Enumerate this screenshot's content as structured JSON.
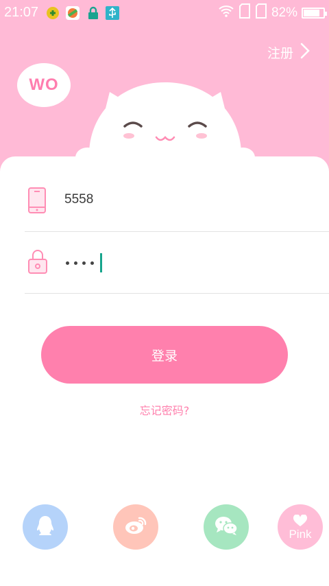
{
  "status_bar": {
    "time": "21:07",
    "battery": "82%",
    "battery_level": 0.82,
    "icons": [
      "game-app-icon",
      "color-app-icon",
      "lock-icon",
      "usb-icon",
      "wifi-icon",
      "sim-card-icon",
      "sim-card-icon",
      "battery-icon"
    ]
  },
  "header": {
    "register_label": "注册",
    "bubble_text": "WO",
    "background_color": "#ffbad6"
  },
  "login_form": {
    "phone_value": "5558",
    "password_dot_count": 4,
    "login_label": "登录",
    "forgot_label": "忘记密码?"
  },
  "social": {
    "pink_label": "Pink",
    "items": [
      "qq-icon",
      "weibo-icon",
      "wechat-icon",
      "pink-heart-icon"
    ]
  },
  "colors": {
    "accent": "#ff80ad",
    "qq": "#b5d3fa",
    "weibo": "#ffc5b9",
    "wechat": "#a6e6c0",
    "pink": "#ffbdd7",
    "cursor": "#17a58c"
  }
}
